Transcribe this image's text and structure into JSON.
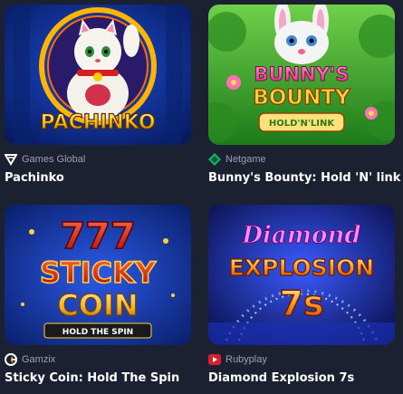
{
  "games": [
    {
      "title": "Pachinko",
      "provider": "Games Global",
      "provider_icon": "games-global-logo",
      "art_text": "PACHINKO",
      "art_colors": {
        "bg": "#0d2a8a",
        "accent": "#f5b800",
        "text": "#ffd23a"
      }
    },
    {
      "title": "Bunny's Bounty: Hold 'N' link",
      "provider": "Netgame",
      "provider_icon": "netgame-logo",
      "art_text": [
        "BUNNY'S",
        "BOUNTY"
      ],
      "art_subtitle": "HOLD'N'LINK",
      "art_colors": {
        "bg": "#2fae2a",
        "accent": "#ffd23a",
        "text": "#ff3fa6"
      }
    },
    {
      "title": "Sticky Coin: Hold The Spin",
      "provider": "Gamzix",
      "provider_icon": "gamzix-logo",
      "art_text": [
        "777",
        "STICKY",
        "COIN"
      ],
      "art_subtitle": "HOLD THE SPIN",
      "art_colors": {
        "bg": "#0e2c8c",
        "accent": "#e02020",
        "text": "#ffcc33"
      }
    },
    {
      "title": "Diamond Explosion 7s",
      "provider": "Rubyplay",
      "provider_icon": "rubyplay-logo",
      "art_text": [
        "Diamond",
        "EXPLOSION",
        "7s"
      ],
      "art_colors": {
        "bg": "#1a2a7a",
        "accent": "#ff7a1a",
        "text": "#ff7aff"
      }
    }
  ]
}
